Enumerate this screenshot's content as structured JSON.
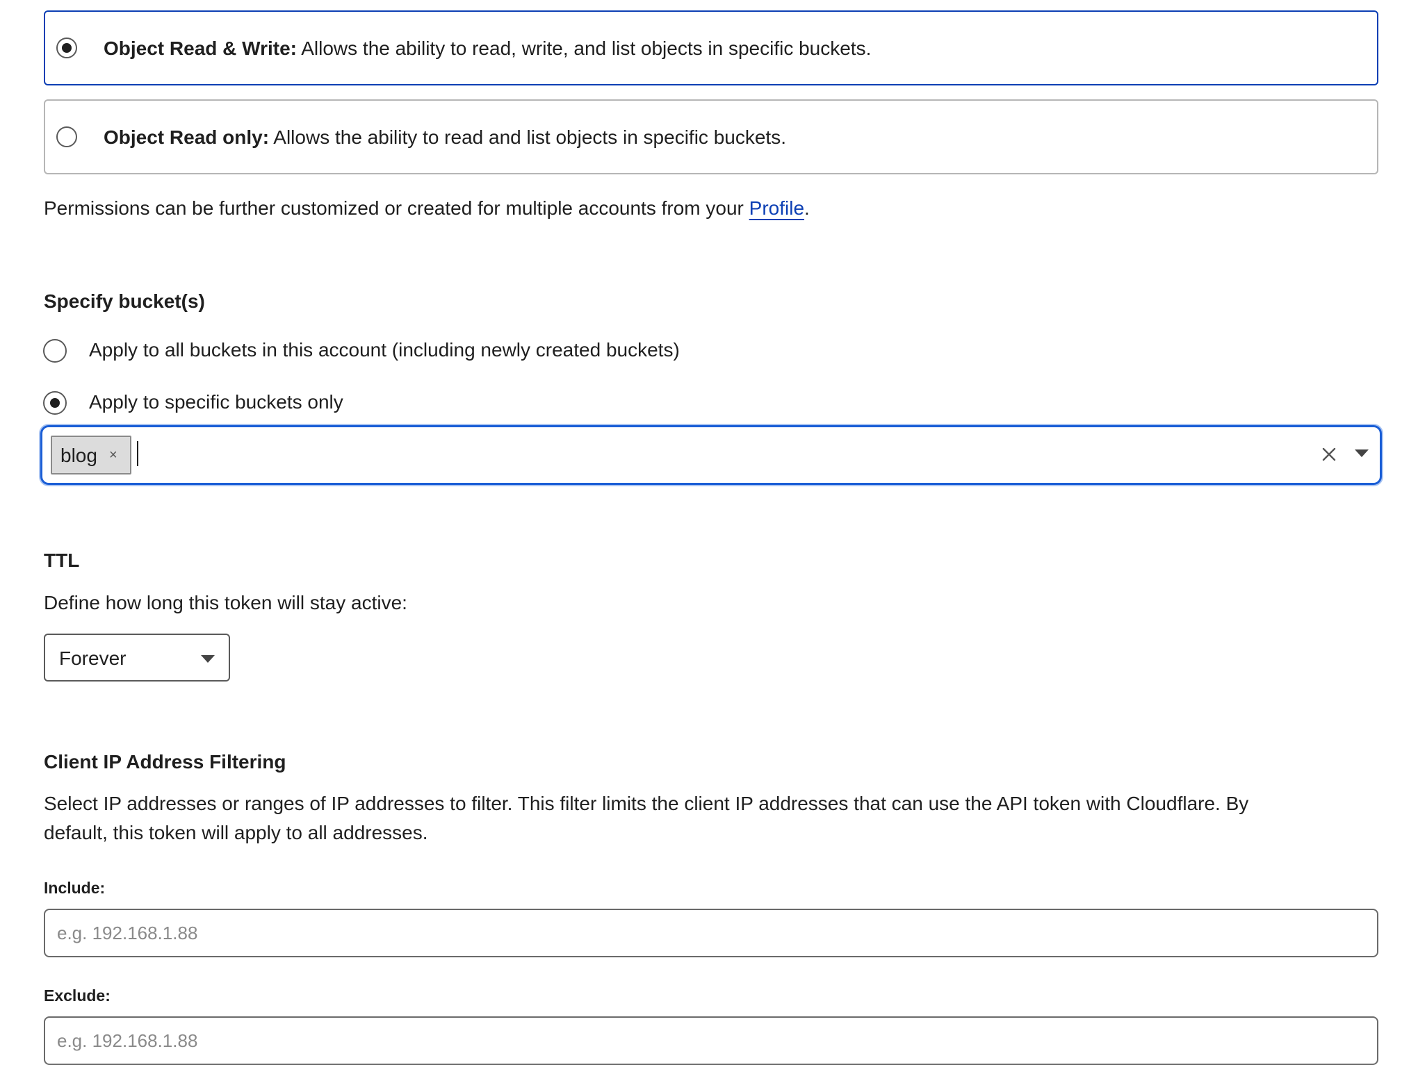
{
  "permissions": {
    "options": [
      {
        "title": "Object Read & Write:",
        "description": "Allows the ability to read, write, and list objects in specific buckets.",
        "selected": true
      },
      {
        "title": "Object Read only:",
        "description": "Allows the ability to read and list objects in specific buckets.",
        "selected": false
      }
    ],
    "note_prefix": "Permissions can be further customized or created for multiple accounts from your",
    "note_link": "Profile",
    "note_suffix": "."
  },
  "buckets": {
    "heading": "Specify bucket(s)",
    "options": [
      {
        "label": "Apply to all buckets in this account (including newly created buckets)",
        "selected": false
      },
      {
        "label": "Apply to specific buckets only",
        "selected": true
      }
    ],
    "selected_tags": [
      {
        "label": "blog",
        "remove_glyph": "×"
      }
    ]
  },
  "ttl": {
    "heading": "TTL",
    "description": "Define how long this token will stay active:",
    "selected_value": "Forever"
  },
  "ip_filtering": {
    "heading": "Client IP Address Filtering",
    "description_line1": "Select IP addresses or ranges of IP addresses to filter. This filter limits the client IP addresses that can use the API token with Cloudflare. By",
    "description_line2": "default, this token will apply to all addresses.",
    "include": {
      "label": "Include:",
      "placeholder": "e.g. 192.168.1.88",
      "value": ""
    },
    "exclude": {
      "label": "Exclude:",
      "placeholder": "e.g. 192.168.1.88",
      "value": ""
    }
  },
  "colors": {
    "accent": "#0c3fb4",
    "focus_ring": "#1a5ed6",
    "text": "#1f1f1f",
    "placeholder": "#8a8a8a"
  }
}
